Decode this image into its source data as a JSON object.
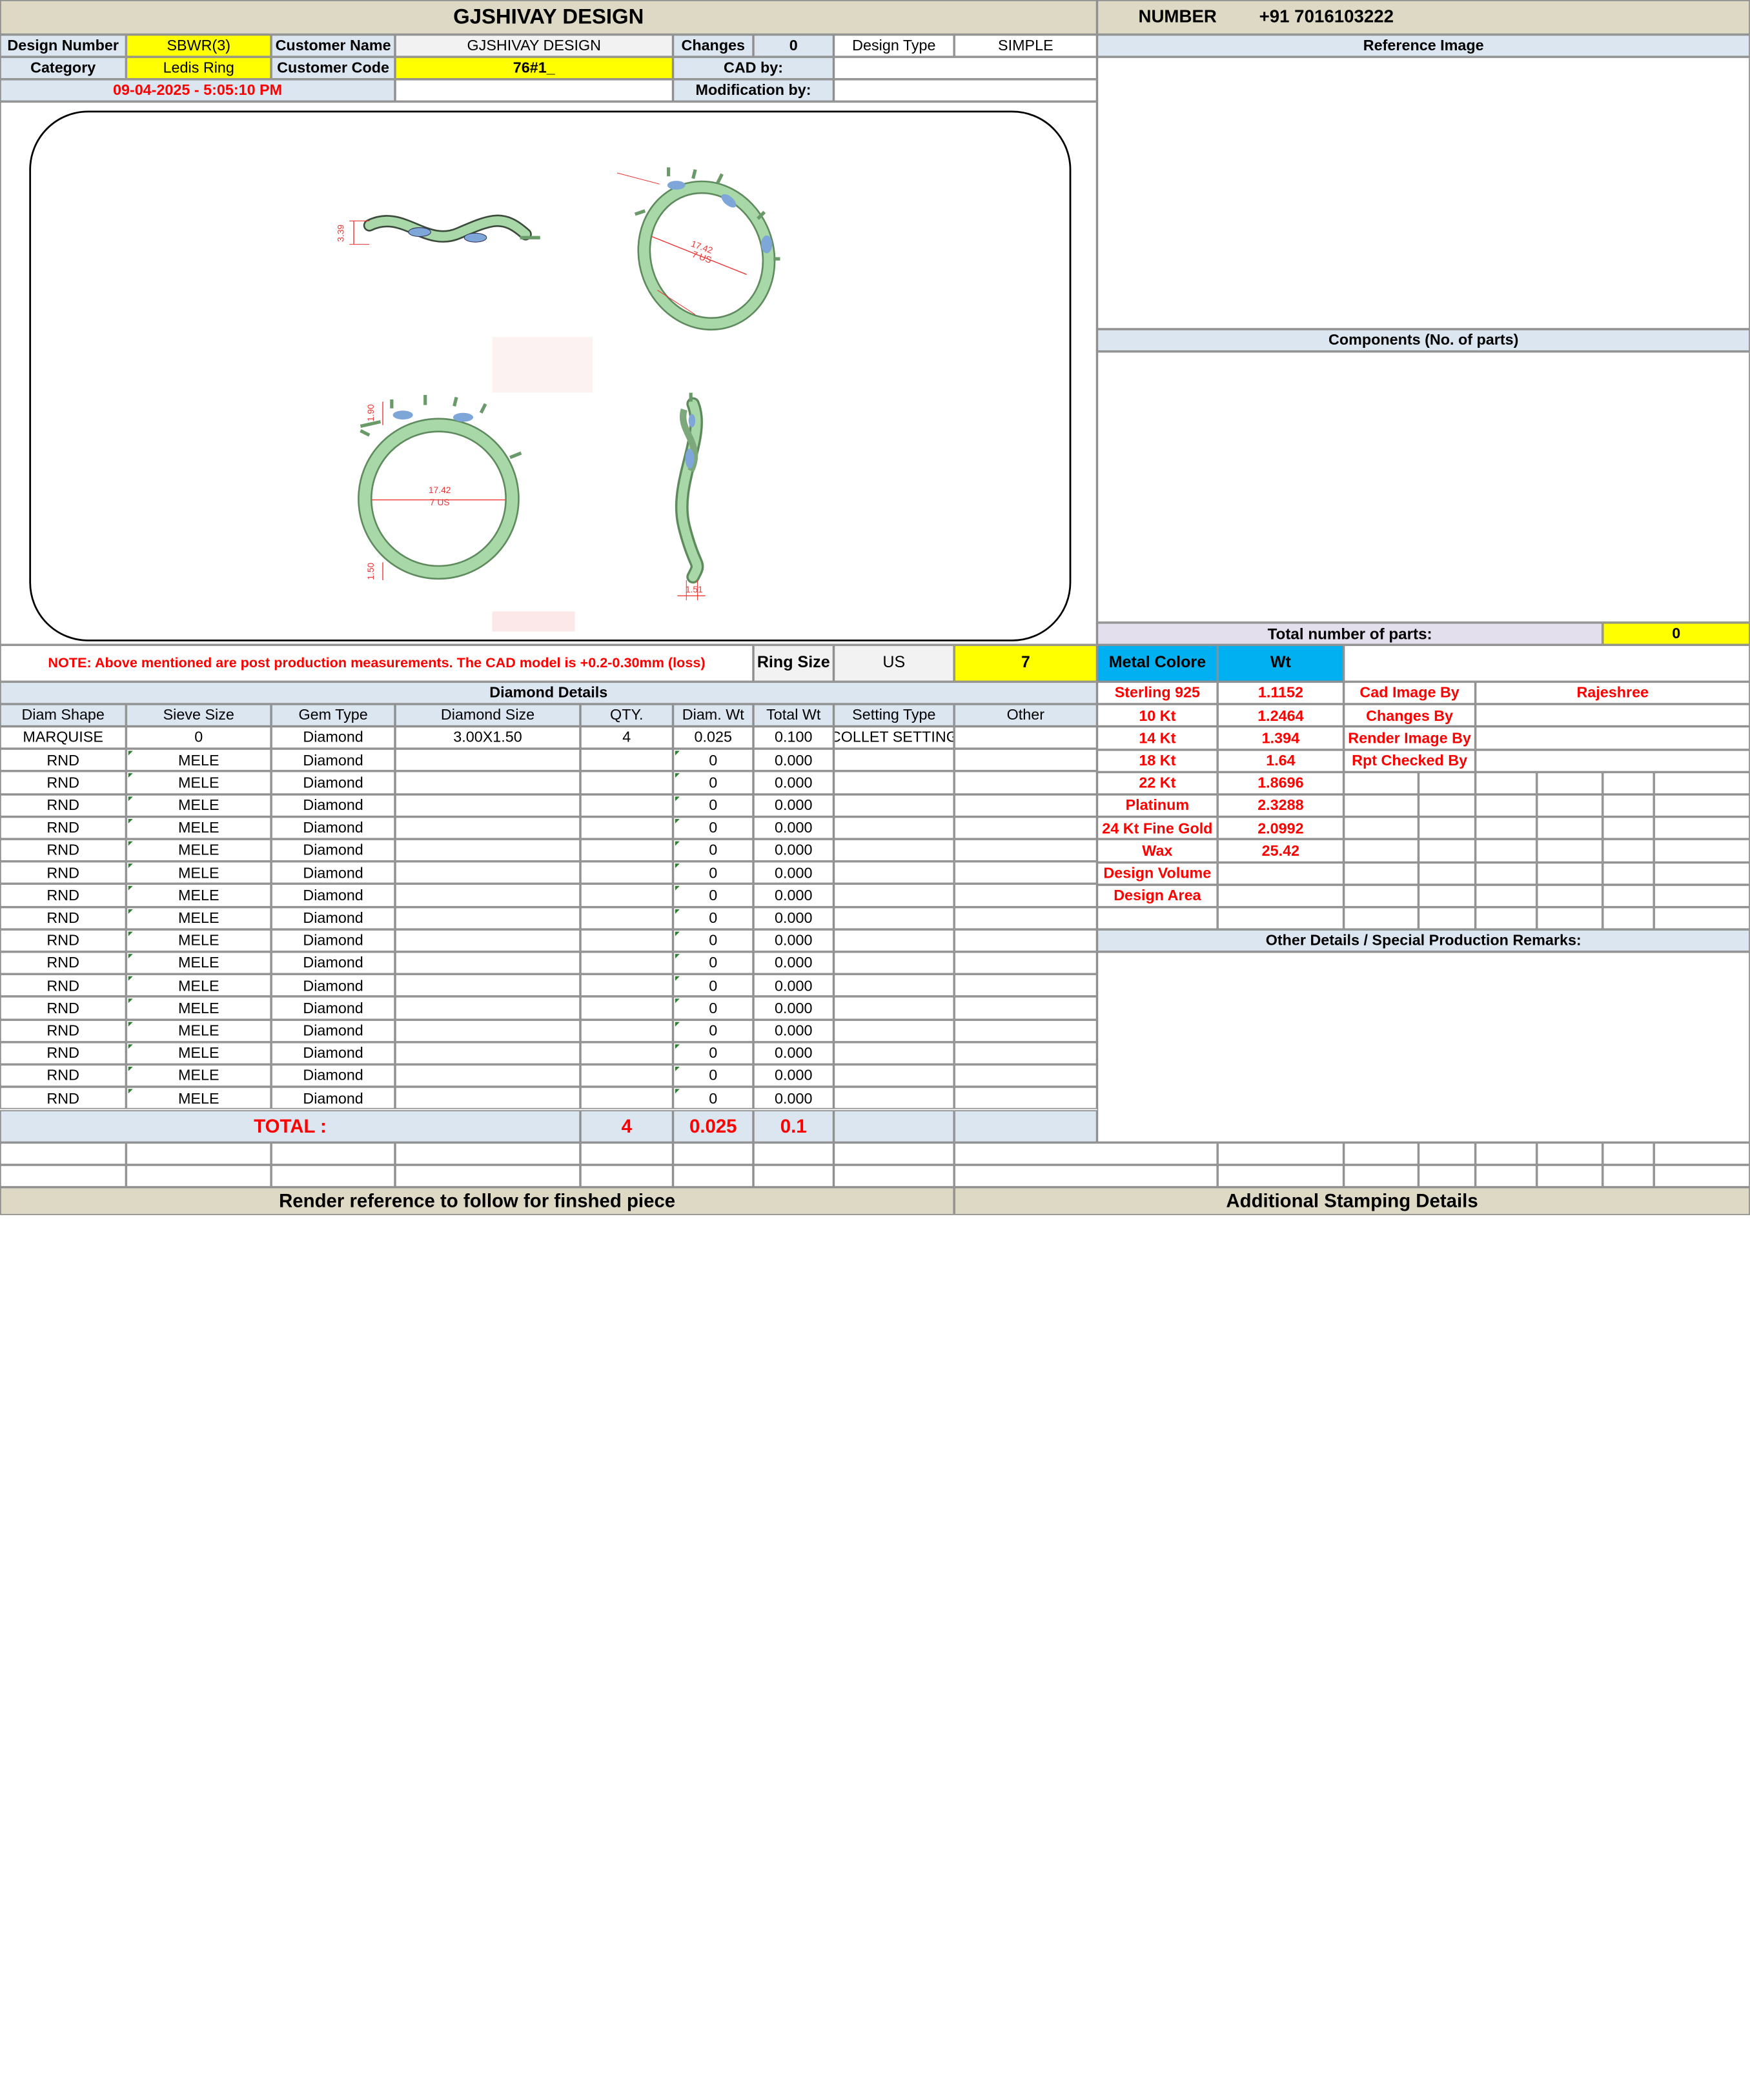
{
  "header": {
    "title": "GJSHIVAY DESIGN",
    "number_label": "NUMBER",
    "number_value": "+91 7016103222"
  },
  "info": {
    "design_number_label": "Design Number",
    "design_number": "SBWR(3)",
    "customer_name_label": "Customer Name",
    "customer_name": "GJSHIVAY DESIGN",
    "changes_label": "Changes",
    "changes": "0",
    "design_type_label": "Design Type",
    "design_type": "SIMPLE",
    "category_label": "Category",
    "category": "Ledis Ring",
    "customer_code_label": "Customer Code",
    "customer_code": "76#1_",
    "cad_by_label": "CAD by:",
    "modification_by_label": "Modification by:",
    "datetime": "09-04-2025 - 5:05:10 PM"
  },
  "drawing": {
    "dim_side_height": "3.39",
    "dim_top_inner": "17.42",
    "dim_top_size": "7 US",
    "dim_front_top": "1.90",
    "dim_front_inner": "17.42",
    "dim_front_size": "7 US",
    "dim_front_bottom": "1.50",
    "dim_profile_width": "1.51"
  },
  "note": {
    "text": "NOTE: Above mentioned are post production measurements. The CAD model is +0.2-0.30mm (loss)",
    "ring_size_label": "Ring Size",
    "ring_size_unit": "US",
    "ring_size": "7"
  },
  "right_panel": {
    "reference_image": "Reference Image",
    "components": "Components (No. of parts)",
    "total_parts_label": "Total number of parts:",
    "total_parts": "0",
    "other_details": "Other Details / Special Production Remarks:"
  },
  "metal": {
    "color_label": "Metal Colore",
    "wt_label": "Wt",
    "rows": [
      {
        "name": "Sterling 925",
        "wt": "1.1152",
        "role": "Cad Image By",
        "person": "Rajeshree"
      },
      {
        "name": "10 Kt",
        "wt": "1.2464",
        "role": "Changes By",
        "person": ""
      },
      {
        "name": "14 Kt",
        "wt": "1.394",
        "role": "Render Image By",
        "person": ""
      },
      {
        "name": "18 Kt",
        "wt": "1.64",
        "role": "Rpt Checked By",
        "person": ""
      },
      {
        "name": "22 Kt",
        "wt": "1.8696"
      },
      {
        "name": "Platinum",
        "wt": "2.3288"
      },
      {
        "name": "24 Kt Fine Gold",
        "wt": "2.0992"
      },
      {
        "name": "Wax",
        "wt": "25.42"
      },
      {
        "name": "Design Volume",
        "wt": ""
      },
      {
        "name": "Design Area",
        "wt": ""
      }
    ]
  },
  "diamonds": {
    "title": "Diamond Details",
    "columns": [
      "Diam Shape",
      "Sieve Size",
      "Gem Type",
      "Diamond Size",
      "QTY.",
      "Diam. Wt",
      "Total Wt",
      "Setting Type",
      "Other"
    ],
    "rows": [
      [
        "MARQUISE",
        "0",
        "Diamond",
        "3.00X1.50",
        "4",
        "0.025",
        "0.100",
        "COLLET SETTING",
        ""
      ],
      [
        "RND",
        "MELE",
        "Diamond",
        "",
        "",
        "0",
        "0.000",
        "",
        ""
      ],
      [
        "RND",
        "MELE",
        "Diamond",
        "",
        "",
        "0",
        "0.000",
        "",
        ""
      ],
      [
        "RND",
        "MELE",
        "Diamond",
        "",
        "",
        "0",
        "0.000",
        "",
        ""
      ],
      [
        "RND",
        "MELE",
        "Diamond",
        "",
        "",
        "0",
        "0.000",
        "",
        ""
      ],
      [
        "RND",
        "MELE",
        "Diamond",
        "",
        "",
        "0",
        "0.000",
        "",
        ""
      ],
      [
        "RND",
        "MELE",
        "Diamond",
        "",
        "",
        "0",
        "0.000",
        "",
        ""
      ],
      [
        "RND",
        "MELE",
        "Diamond",
        "",
        "",
        "0",
        "0.000",
        "",
        ""
      ],
      [
        "RND",
        "MELE",
        "Diamond",
        "",
        "",
        "0",
        "0.000",
        "",
        ""
      ],
      [
        "RND",
        "MELE",
        "Diamond",
        "",
        "",
        "0",
        "0.000",
        "",
        ""
      ],
      [
        "RND",
        "MELE",
        "Diamond",
        "",
        "",
        "0",
        "0.000",
        "",
        ""
      ],
      [
        "RND",
        "MELE",
        "Diamond",
        "",
        "",
        "0",
        "0.000",
        "",
        ""
      ],
      [
        "RND",
        "MELE",
        "Diamond",
        "",
        "",
        "0",
        "0.000",
        "",
        ""
      ],
      [
        "RND",
        "MELE",
        "Diamond",
        "",
        "",
        "0",
        "0.000",
        "",
        ""
      ],
      [
        "RND",
        "MELE",
        "Diamond",
        "",
        "",
        "0",
        "0.000",
        "",
        ""
      ],
      [
        "RND",
        "MELE",
        "Diamond",
        "",
        "",
        "0",
        "0.000",
        "",
        ""
      ],
      [
        "RND",
        "MELE",
        "Diamond",
        "",
        "",
        "0",
        "0.000",
        "",
        ""
      ]
    ],
    "total_label": "TOTAL :",
    "total_qty": "4",
    "total_diam_wt": "0.025",
    "total_wt": "0.1"
  },
  "footer": {
    "render_reference": "Render reference to follow for finshed piece",
    "stamping": "Additional Stamping Details"
  },
  "colors": {
    "header_bg": "#ddd9c4",
    "label_bg": "#dce6f1",
    "highlight": "#ffff00",
    "metal_header": "#00b0f0",
    "accent_red": "#ff0000",
    "ring_green": "#a8d8a8",
    "stone_blue": "#7ea6d8"
  }
}
